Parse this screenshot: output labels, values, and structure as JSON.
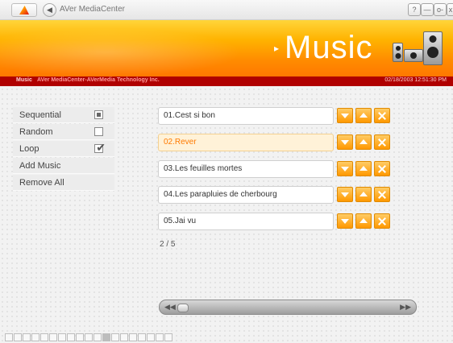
{
  "window": {
    "title": "AVer MediaCenter",
    "buttons": {
      "help": "?",
      "minimize": "—",
      "maximize": "o-",
      "close": "x"
    }
  },
  "banner": {
    "section_title": "Music",
    "arrow": "▸"
  },
  "infobar": {
    "label": "Music",
    "company": "AVer MediaCenter-AVerMedia Technology Inc.",
    "datetime": "02/18/2003 12:51:30 PM"
  },
  "menu": {
    "items": [
      {
        "label": "Sequential",
        "control": "radio-selected"
      },
      {
        "label": "Random",
        "control": "checkbox-unchecked"
      },
      {
        "label": "Loop",
        "control": "checkbox-checked"
      },
      {
        "label": "Add Music"
      },
      {
        "label": "Remove All"
      }
    ]
  },
  "playlist": {
    "tracks": [
      {
        "title": "01.Cest si bon",
        "active": false
      },
      {
        "title": "02.Rever",
        "active": true
      },
      {
        "title": "03.Les feuilles mortes",
        "active": false
      },
      {
        "title": "04.Les parapluies de cherbourg",
        "active": false
      },
      {
        "title": "05.Jai vu",
        "active": false
      }
    ],
    "page": "2 / 5"
  },
  "scrollbar": {
    "left_arrow": "◀◀",
    "right_arrow": "▶▶"
  },
  "colors": {
    "banner_top": "#ffd53a",
    "banner_bottom": "#ff7800",
    "infobar": "#b00000",
    "active_track_text": "#ff7a00",
    "track_button": "#ff9800"
  }
}
